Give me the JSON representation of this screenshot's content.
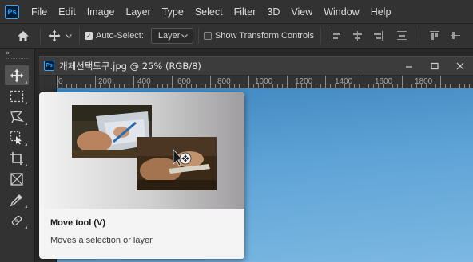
{
  "app": {
    "logo_text": "Ps",
    "menu": [
      "File",
      "Edit",
      "Image",
      "Layer",
      "Type",
      "Select",
      "Filter",
      "3D",
      "View",
      "Window",
      "Help"
    ]
  },
  "options": {
    "auto_select_label": "Auto-Select:",
    "auto_select_checked": true,
    "layer_select_value": "Layer",
    "show_transform_label": "Show Transform Controls",
    "show_transform_checked": false
  },
  "toolbar": {
    "collapse_label": "»",
    "tools": [
      "move-tool",
      "rectangular-marquee-tool",
      "lasso-tool",
      "object-selection-tool",
      "crop-tool",
      "frame-tool",
      "eyedropper-tool",
      "spot-healing-brush-tool"
    ]
  },
  "document": {
    "logo_text": "Ps",
    "title": "개체선택도구.jpg @ 25% (RGB/8)",
    "ruler_labels": [
      "0",
      "200",
      "400",
      "600",
      "800",
      "1000",
      "1200",
      "1400",
      "1600",
      "1800"
    ],
    "window_buttons": [
      "minimize",
      "maximize",
      "close"
    ]
  },
  "tooltip": {
    "title": "Move tool (V)",
    "description": "Moves a selection or layer"
  },
  "colors": {
    "ps_blue": "#31a8ff",
    "ps_dark": "#001e36",
    "panel": "#323232",
    "canvas_sky": "#5ea3d6"
  }
}
